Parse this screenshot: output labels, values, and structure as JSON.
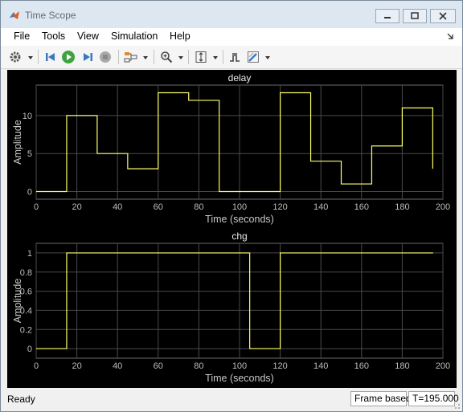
{
  "window": {
    "title": "Time Scope"
  },
  "menu": [
    "File",
    "Tools",
    "View",
    "Simulation",
    "Help"
  ],
  "toolbar": {
    "icons": [
      "gear-icon",
      "step-back-icon",
      "run-icon",
      "step-forward-icon",
      "stop-icon",
      "signal-selector-icon",
      "zoom-in-icon",
      "autoscale-icon",
      "triggers-icon",
      "style-icon"
    ]
  },
  "colors": {
    "trace": "#ffff66",
    "background": "#000000",
    "grid": "#4a4a4a",
    "axis_text": "#bdbdbd"
  },
  "chart_data": [
    {
      "type": "line",
      "title": "delay",
      "xlabel": "Time (seconds)",
      "ylabel": "Amplitude",
      "xlim": [
        0,
        200
      ],
      "ylim": [
        -1,
        14
      ],
      "xticks": [
        0,
        20,
        40,
        60,
        80,
        100,
        120,
        140,
        160,
        180,
        200
      ],
      "yticks": [
        0,
        5,
        10
      ],
      "grid": true,
      "step": true,
      "x": [
        0,
        15,
        30,
        45,
        60,
        75,
        90,
        105,
        120,
        135,
        150,
        165,
        180,
        195
      ],
      "y": [
        0,
        10,
        5,
        3,
        13,
        12,
        0,
        0,
        13,
        4,
        1,
        6,
        11,
        3
      ]
    },
    {
      "type": "line",
      "title": "chg",
      "xlabel": "Time (seconds)",
      "ylabel": "Amplitude",
      "xlim": [
        0,
        200
      ],
      "ylim": [
        -0.1,
        1.1
      ],
      "xticks": [
        0,
        20,
        40,
        60,
        80,
        100,
        120,
        140,
        160,
        180,
        200
      ],
      "yticks": [
        0,
        0.2,
        0.4,
        0.6,
        0.8,
        1
      ],
      "grid": true,
      "step": true,
      "x": [
        0,
        15,
        30,
        45,
        60,
        75,
        90,
        105,
        120,
        135,
        150,
        165,
        180,
        195
      ],
      "y": [
        0,
        1,
        1,
        1,
        1,
        1,
        1,
        0,
        1,
        1,
        1,
        1,
        1,
        1
      ]
    }
  ],
  "status": {
    "text": "Ready",
    "mode": "Frame based",
    "time": "T=195.000"
  }
}
